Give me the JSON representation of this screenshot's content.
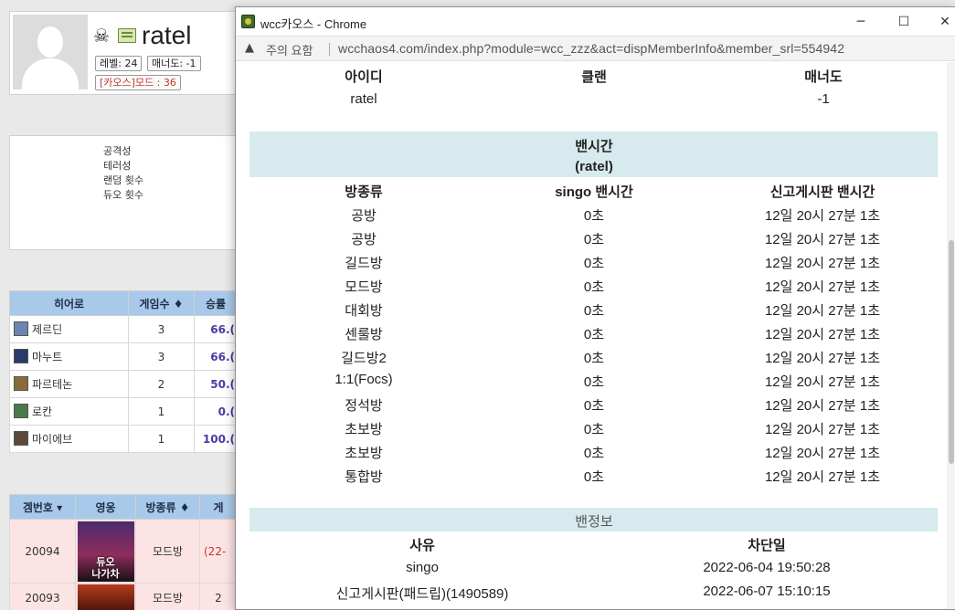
{
  "profile": {
    "nickname": "ratel",
    "level": "레벨: 24",
    "manner": "매너도: -1",
    "chaos_mode": "[카오스]모드 : 36"
  },
  "stats_labels": [
    "공격성",
    "테러성",
    "랜덤 횟수",
    "듀오 횟수"
  ],
  "hero_table": {
    "headers": [
      "히어로",
      "게임수 ♦",
      "승률"
    ],
    "rows": [
      {
        "name": "제르딘",
        "games": "3",
        "rate": "66.("
      },
      {
        "name": "마누트",
        "games": "3",
        "rate": "66.("
      },
      {
        "name": "파르테논",
        "games": "2",
        "rate": "50.("
      },
      {
        "name": "로칸",
        "games": "1",
        "rate": "0.("
      },
      {
        "name": "마이에브",
        "games": "1",
        "rate": "100.("
      }
    ]
  },
  "game_table": {
    "headers": [
      "겜번호 ▾",
      "영웅",
      "방종류 ♦",
      "게"
    ],
    "rows": [
      {
        "id": "20094",
        "hero_badge": "듀오\n나가차",
        "room": "모드방",
        "extra": "(22-"
      },
      {
        "id": "20093",
        "hero_badge": "",
        "room": "모드방",
        "extra": "2"
      }
    ]
  },
  "window": {
    "title": "wcc카오스 - Chrome",
    "minimize": "─",
    "maximize": "☐",
    "close": "✕",
    "warning_label": "주의 요함",
    "url": "wcchaos4.com/index.php?module=wcc_zzz&act=dispMemberInfo&member_srl=554942"
  },
  "member_info": {
    "headers": [
      "아이디",
      "클랜",
      "매너도"
    ],
    "values": [
      "ratel",
      "",
      "-1"
    ]
  },
  "ban_time": {
    "title": "밴시간",
    "subtitle": "(ratel)",
    "headers": [
      "방종류",
      "singo 밴시간",
      "신고게시판 밴시간"
    ],
    "rows": [
      [
        "공방",
        "0초",
        "12일 20시 27분 1초"
      ],
      [
        "공방",
        "0초",
        "12일 20시 27분 1초"
      ],
      [
        "길드방",
        "0초",
        "12일 20시 27분 1초"
      ],
      [
        "모드방",
        "0초",
        "12일 20시 27분 1초"
      ],
      [
        "대회방",
        "0초",
        "12일 20시 27분 1초"
      ],
      [
        "센룰방",
        "0초",
        "12일 20시 27분 1초"
      ],
      [
        "길드방2",
        "0초",
        "12일 20시 27분 1초"
      ],
      [
        "1:1(Focs)",
        "0초",
        "12일 20시 27분 1초"
      ],
      [
        "정석방",
        "0초",
        "12일 20시 27분 1초"
      ],
      [
        "초보방",
        "0초",
        "12일 20시 27분 1초"
      ],
      [
        "초보방",
        "0초",
        "12일 20시 27분 1초"
      ],
      [
        "통합방",
        "0초",
        "12일 20시 27분 1초"
      ]
    ]
  },
  "ban_info": {
    "title": "밴정보",
    "headers": [
      "사유",
      "차단일"
    ],
    "rows": [
      [
        "singo",
        "2022-06-04 19:50:28"
      ],
      [
        "신고게시판(패드립)(1490589)",
        "2022-06-07 15:10:15"
      ]
    ]
  },
  "colors": {
    "table_header_bg": "#a9c9ea",
    "band_bg": "#d7ebee",
    "game_row_bg": "#fde4e4",
    "rate_text": "#4b3aa3"
  }
}
